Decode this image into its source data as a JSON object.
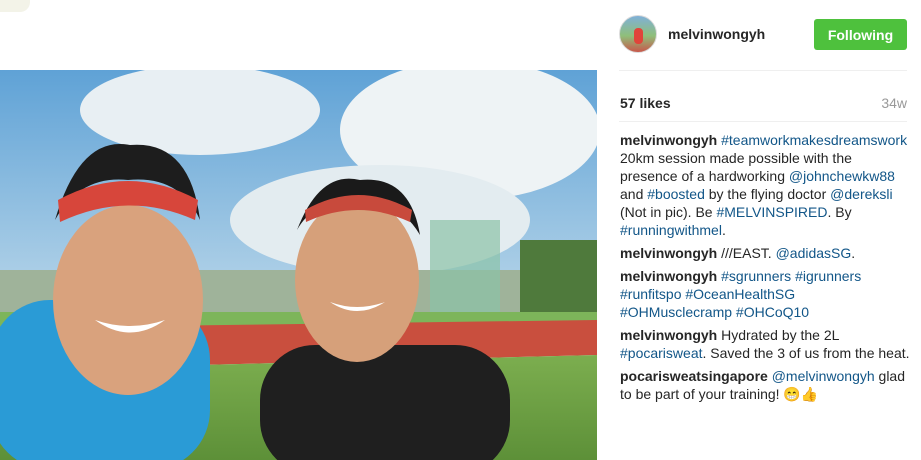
{
  "post": {
    "username": "melvinwongyh",
    "follow_label": "Following",
    "likes": "57 likes",
    "time_ago": "34w",
    "avatar_icon": "profile-avatar",
    "follow_color": "#4ec13d",
    "link_color": "#125688"
  },
  "comments": [
    {
      "user": "melvinwongyh",
      "parts": [
        {
          "t": " "
        },
        {
          "t": "#teamworkmakesdreamswork",
          "link": true
        },
        {
          "t": " 20km session made possible with the presence of a hardworking "
        },
        {
          "t": "@johnchewkw88",
          "link": true
        },
        {
          "t": " and "
        },
        {
          "t": "#boosted",
          "link": true
        },
        {
          "t": " by the flying doctor "
        },
        {
          "t": "@dereksli",
          "link": true
        },
        {
          "t": " (Not in pic). Be "
        },
        {
          "t": "#MELVINSPIRED",
          "link": true
        },
        {
          "t": ". By "
        },
        {
          "t": "#runningwithmel",
          "link": true
        },
        {
          "t": "."
        }
      ]
    },
    {
      "user": "melvinwongyh",
      "parts": [
        {
          "t": " ///EAST. "
        },
        {
          "t": "@adidasSG",
          "link": true
        },
        {
          "t": "."
        }
      ]
    },
    {
      "user": "melvinwongyh",
      "parts": [
        {
          "t": " "
        },
        {
          "t": "#sgrunners",
          "link": true
        },
        {
          "t": " "
        },
        {
          "t": "#igrunners",
          "link": true
        },
        {
          "t": " "
        },
        {
          "t": "#runfitspo",
          "link": true
        },
        {
          "t": " "
        },
        {
          "t": "#OceanHealthSG",
          "link": true
        },
        {
          "t": " "
        },
        {
          "t": "#OHMusclecramp",
          "link": true
        },
        {
          "t": " "
        },
        {
          "t": "#OHCoQ10",
          "link": true
        }
      ]
    },
    {
      "user": "melvinwongyh",
      "parts": [
        {
          "t": " Hydrated by the 2L "
        },
        {
          "t": "#pocarisweat",
          "link": true
        },
        {
          "t": ". Saved the 3 of us from the heat."
        }
      ]
    },
    {
      "user": "pocarisweatsingapore",
      "parts": [
        {
          "t": " "
        },
        {
          "t": "@melvinwongyh",
          "link": true
        },
        {
          "t": " glad to be part of your training! 😁👍"
        }
      ]
    }
  ]
}
